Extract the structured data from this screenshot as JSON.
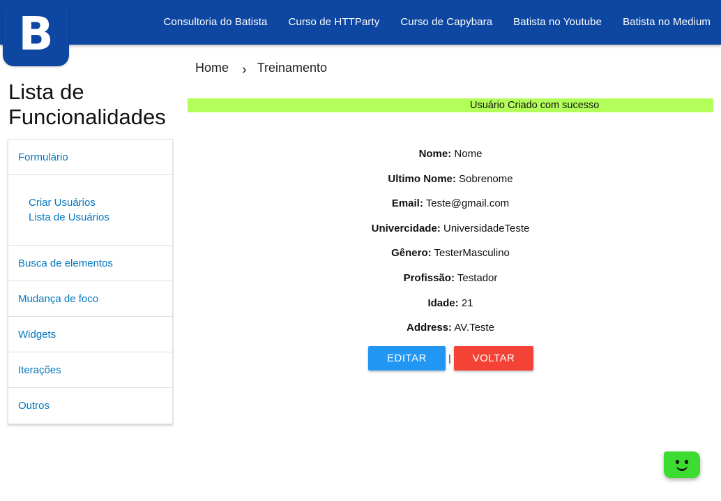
{
  "logo": {
    "letter": "B"
  },
  "nav": {
    "links": [
      "Consultoria do Batista",
      "Curso de HTTParty",
      "Curso de Capybara",
      "Batista no Youtube",
      "Batista no Medium"
    ]
  },
  "sidebar": {
    "title_line1": "Lista de",
    "title_line2": "Funcionalidades",
    "items": [
      "Formulário",
      "Busca de elementos",
      "Mudança de foco",
      "Widgets",
      "Iterações",
      "Outros"
    ],
    "submenu": [
      "Criar Usuários",
      "Lista de Usuários"
    ]
  },
  "breadcrumb": {
    "home": "Home",
    "separator": "›",
    "current": "Treinamento"
  },
  "toast": {
    "message": "Usuário Criado com sucesso",
    "color": "#b2ff59"
  },
  "user": {
    "fields": [
      {
        "label": "Nome:",
        "value": "Nome"
      },
      {
        "label": "Ultimo Nome:",
        "value": "Sobrenome"
      },
      {
        "label": "Email:",
        "value": "Teste@gmail.com"
      },
      {
        "label": "Univercidade:",
        "value": "UniversidadeTeste"
      },
      {
        "label": "Gênero:",
        "value": "TesterMasculino"
      },
      {
        "label": "Profissão:",
        "value": "Testador"
      },
      {
        "label": "Idade:",
        "value": "21"
      },
      {
        "label": "Address:",
        "value": "AV.Teste"
      }
    ]
  },
  "actions": {
    "edit_label": "EDITAR",
    "separator": "|",
    "back_label": "VOLTAR"
  },
  "colors": {
    "header": "#0d47a1",
    "link": "#0277bd",
    "edit": "#2196f3",
    "back": "#f44336",
    "chat": "#3ddc30"
  },
  "chat_widget": {
    "icon": "chat-bot-icon"
  }
}
